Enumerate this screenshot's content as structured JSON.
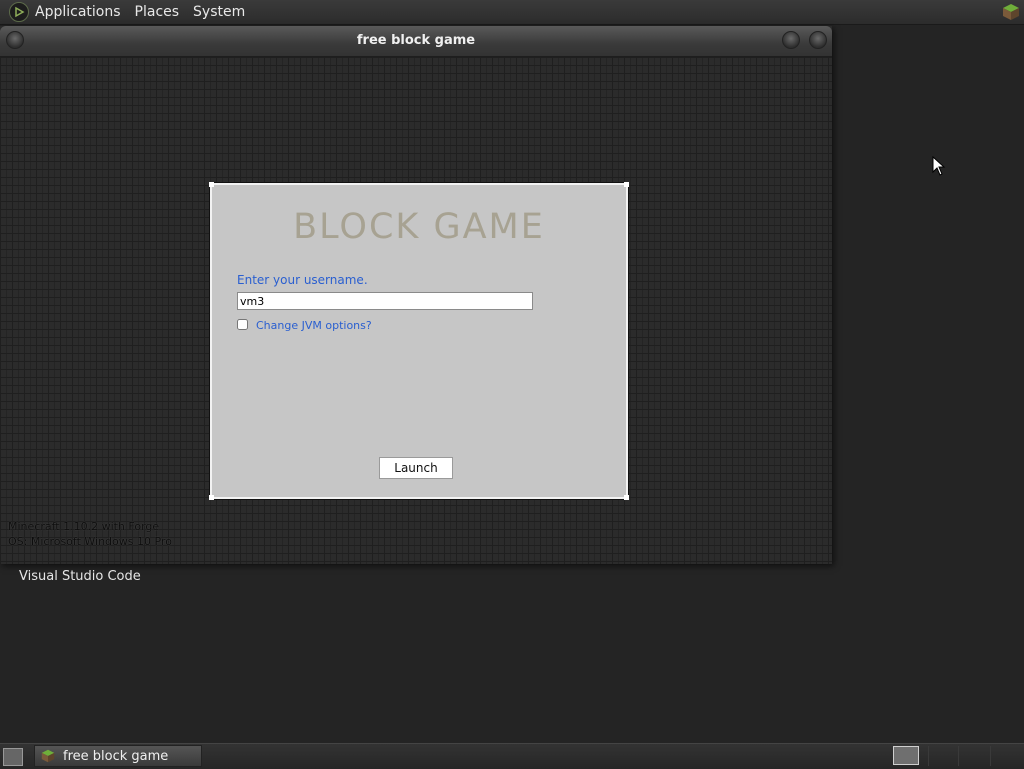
{
  "top_panel": {
    "menus": [
      "Applications",
      "Places",
      "System"
    ],
    "logo_icon": "distro-logo-icon",
    "tray_icon": "grass-block-icon"
  },
  "window": {
    "title": "free block game",
    "dialog": {
      "game_title": "BLOCK GAME",
      "username_label": "Enter your username.",
      "username_value": "vm3",
      "jvm_checkbox_label": "Change JVM options?",
      "jvm_checked": false,
      "launch_label": "Launch"
    },
    "info_lines": [
      "Minecraft 1.10.2 with Forge",
      "OS: Microsoft Windows 10 Pro"
    ]
  },
  "desktop": {
    "icon_label": "Visual Studio Code"
  },
  "taskbar": {
    "task_label": "free block game"
  },
  "colors": {
    "link_blue": "#2a5fd0",
    "dialog_bg": "#c6c6c6",
    "title_beige": "#a7a292"
  }
}
